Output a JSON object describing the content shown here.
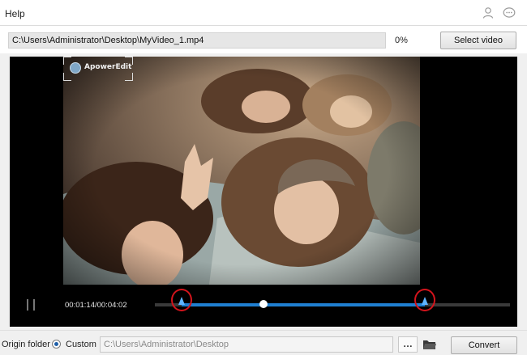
{
  "menu": {
    "help_label": "Help"
  },
  "toolbar_icons": [
    "user-icon",
    "chat-icon"
  ],
  "file": {
    "path": "C:\\Users\\Administrator\\Desktop\\MyVideo_1.mp4",
    "progress_text": "0%",
    "progress": 0,
    "select_label": "Select video"
  },
  "player": {
    "watermark_text": "ApowerEdit",
    "time_text": "00:01:14/00:04:02",
    "playhead_fraction": 0.306,
    "trim_start_fraction": 0.076,
    "trim_end_fraction": 0.761
  },
  "output": {
    "origin_label": "Origin folder",
    "custom_label": "Custom",
    "folder_value": "C:\\Users\\Administrator\\Desktop",
    "dots_label": "…",
    "convert_label": "Convert"
  },
  "colors": {
    "accent": "#1f7fd1",
    "marker": "#5fb4ff",
    "highlight_ring": "#d4141c"
  }
}
